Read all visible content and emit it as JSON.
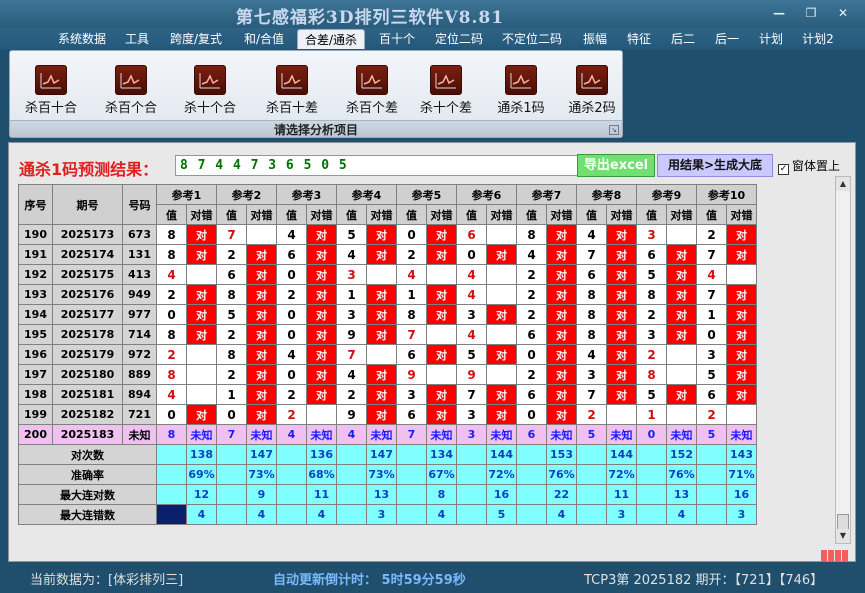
{
  "window": {
    "title": "第七感福彩3D排列三软件V8.81",
    "minimize": "—",
    "restore": "❐",
    "close": "✕"
  },
  "menu": [
    "系统数据",
    "工具",
    "跨度/复式",
    "和/合值",
    "合差/通杀",
    "百十个",
    "定位二码",
    "不定位二码",
    "振幅",
    "特征",
    "后二",
    "后一",
    "计划",
    "计划2"
  ],
  "ribbon": {
    "tools": [
      "杀百十合",
      "杀百个合",
      "杀十个合",
      "杀百十差",
      "杀百个差",
      "杀十个差",
      "通杀1码",
      "通杀2码"
    ],
    "icon": "chart-icon",
    "caption": "请选择分析项目"
  },
  "prediction": {
    "label": "通杀1码预测结果：",
    "value": "8 7 4 4 7 3 6 5 0 5"
  },
  "buttons": {
    "excel": "导出excel",
    "big": "用结果>生成大底",
    "on_top": "窗体置上"
  },
  "table": {
    "headers": {
      "seq": "序号",
      "issue": "期号",
      "number": "号码",
      "value": "值",
      "right_wrong": "对错"
    },
    "refs": [
      "参考1",
      "参考2",
      "参考3",
      "参考4",
      "参考5",
      "参考6",
      "参考7",
      "参考8",
      "参考9",
      "参考10"
    ],
    "rows": [
      {
        "seq": "190",
        "issue": "2025173",
        "num": "673",
        "vals": [
          "8",
          "7",
          "4",
          "5",
          "0",
          "6",
          "8",
          "4",
          "3",
          "2"
        ],
        "hits": [
          1,
          0,
          1,
          1,
          1,
          0,
          1,
          1,
          0,
          1
        ],
        "red": [
          0,
          1,
          0,
          0,
          0,
          1,
          0,
          0,
          1,
          0
        ]
      },
      {
        "seq": "191",
        "issue": "2025174",
        "num": "131",
        "vals": [
          "8",
          "2",
          "6",
          "4",
          "2",
          "0",
          "4",
          "7",
          "6",
          "7"
        ],
        "hits": [
          1,
          1,
          1,
          1,
          1,
          1,
          1,
          1,
          1,
          1
        ],
        "red": [
          0,
          0,
          0,
          0,
          0,
          0,
          0,
          0,
          0,
          0
        ]
      },
      {
        "seq": "192",
        "issue": "2025175",
        "num": "413",
        "vals": [
          "4",
          "6",
          "0",
          "3",
          "4",
          "4",
          "2",
          "6",
          "5",
          "4"
        ],
        "hits": [
          0,
          1,
          1,
          0,
          0,
          0,
          1,
          1,
          1,
          0
        ],
        "red": [
          1,
          0,
          0,
          1,
          1,
          1,
          0,
          0,
          0,
          1
        ]
      },
      {
        "seq": "193",
        "issue": "2025176",
        "num": "949",
        "vals": [
          "2",
          "8",
          "2",
          "1",
          "1",
          "4",
          "2",
          "8",
          "8",
          "7"
        ],
        "hits": [
          1,
          1,
          1,
          1,
          1,
          0,
          1,
          1,
          1,
          1
        ],
        "red": [
          0,
          0,
          0,
          0,
          0,
          1,
          0,
          0,
          0,
          0
        ]
      },
      {
        "seq": "194",
        "issue": "2025177",
        "num": "977",
        "vals": [
          "0",
          "5",
          "0",
          "3",
          "8",
          "3",
          "2",
          "8",
          "2",
          "1"
        ],
        "hits": [
          1,
          1,
          1,
          1,
          1,
          1,
          1,
          1,
          1,
          1
        ],
        "red": [
          0,
          0,
          0,
          0,
          0,
          0,
          0,
          0,
          0,
          0
        ]
      },
      {
        "seq": "195",
        "issue": "2025178",
        "num": "714",
        "vals": [
          "8",
          "2",
          "0",
          "9",
          "7",
          "4",
          "6",
          "8",
          "3",
          "0"
        ],
        "hits": [
          1,
          1,
          1,
          1,
          0,
          0,
          1,
          1,
          1,
          1
        ],
        "red": [
          0,
          0,
          0,
          0,
          1,
          1,
          0,
          0,
          0,
          0
        ]
      },
      {
        "seq": "196",
        "issue": "2025179",
        "num": "972",
        "vals": [
          "2",
          "8",
          "4",
          "7",
          "6",
          "5",
          "0",
          "4",
          "2",
          "3"
        ],
        "hits": [
          0,
          1,
          1,
          0,
          1,
          1,
          1,
          1,
          0,
          1
        ],
        "red": [
          1,
          0,
          0,
          1,
          0,
          0,
          0,
          0,
          1,
          0
        ]
      },
      {
        "seq": "197",
        "issue": "2025180",
        "num": "889",
        "vals": [
          "8",
          "2",
          "0",
          "4",
          "9",
          "9",
          "2",
          "3",
          "8",
          "5"
        ],
        "hits": [
          0,
          1,
          1,
          1,
          0,
          0,
          1,
          1,
          0,
          1
        ],
        "red": [
          1,
          0,
          0,
          0,
          1,
          1,
          0,
          0,
          1,
          0
        ]
      },
      {
        "seq": "198",
        "issue": "2025181",
        "num": "894",
        "vals": [
          "4",
          "1",
          "2",
          "2",
          "3",
          "7",
          "6",
          "7",
          "5",
          "6"
        ],
        "hits": [
          0,
          1,
          1,
          1,
          1,
          1,
          1,
          1,
          1,
          1
        ],
        "red": [
          1,
          0,
          0,
          0,
          0,
          0,
          0,
          0,
          0,
          0
        ]
      },
      {
        "seq": "199",
        "issue": "2025182",
        "num": "721",
        "vals": [
          "0",
          "0",
          "2",
          "9",
          "6",
          "3",
          "0",
          "2",
          "1",
          "2"
        ],
        "hits": [
          1,
          1,
          0,
          1,
          1,
          1,
          1,
          0,
          0,
          0
        ],
        "red": [
          0,
          0,
          1,
          0,
          0,
          0,
          0,
          1,
          1,
          1
        ]
      }
    ],
    "current": {
      "seq": "200",
      "issue": "2025183",
      "num": "未知",
      "vals": [
        "8",
        "7",
        "4",
        "4",
        "7",
        "3",
        "6",
        "5",
        "0",
        "5"
      ],
      "mark": "未知"
    },
    "stats": [
      {
        "label": "对次数",
        "vals": [
          "138",
          "147",
          "136",
          "147",
          "134",
          "144",
          "153",
          "144",
          "152",
          "143"
        ]
      },
      {
        "label": "准确率",
        "vals": [
          "69%",
          "73%",
          "68%",
          "73%",
          "67%",
          "72%",
          "76%",
          "72%",
          "76%",
          "71%"
        ]
      },
      {
        "label": "最大连对数",
        "vals": [
          "12",
          "9",
          "11",
          "13",
          "8",
          "16",
          "22",
          "11",
          "13",
          "16"
        ]
      },
      {
        "label": "最大连错数",
        "vals": [
          "4",
          "4",
          "4",
          "3",
          "4",
          "5",
          "4",
          "3",
          "4",
          "3"
        ]
      }
    ],
    "hit_mark": "对"
  },
  "status": {
    "source": "当前数据为：[体彩排列三]",
    "countdown": "自动更新倒计时： 5时59分59秒",
    "draw": "TCP3第 2025182 期开：【721】【746】"
  },
  "colors": {
    "hit": "#ff0000",
    "stat": "#7fffff",
    "current": "#f0c0f0",
    "accent": "#1a1aff"
  }
}
